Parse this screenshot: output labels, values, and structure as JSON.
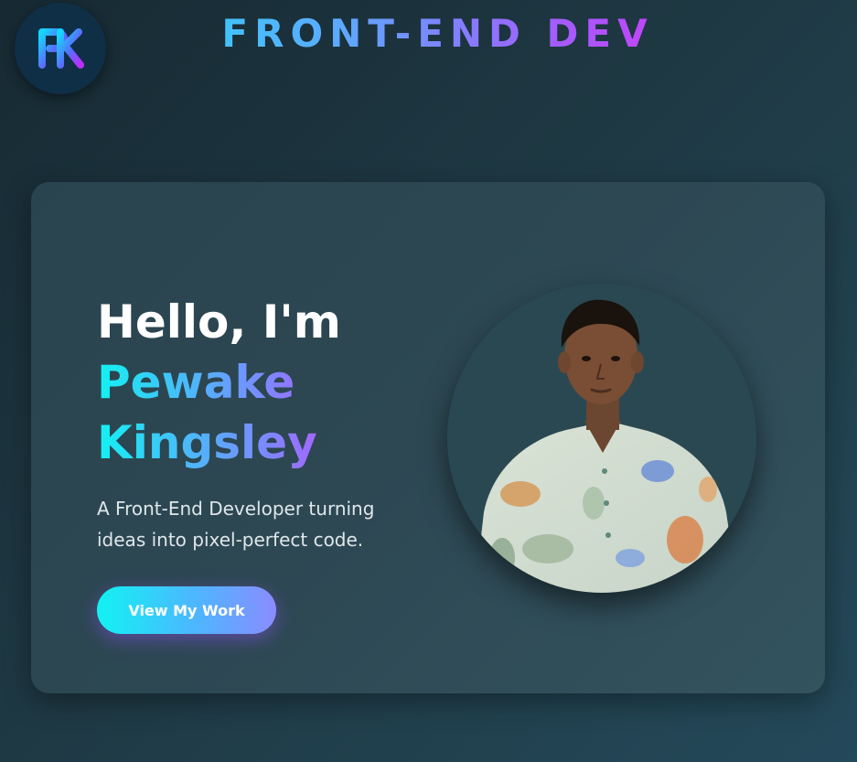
{
  "header": {
    "logo_text": "PK",
    "logo_icon": "pk-monogram-logo",
    "brand_title": "FRONT-END DEV"
  },
  "hero": {
    "greeting": "Hello, I'm",
    "name": "Pewake Kingsley",
    "tagline": "A Front-End Developer turning ideas into pixel-perfect code.",
    "cta_label": "View My Work",
    "profile_image": "profile-photo"
  },
  "colors": {
    "accent_cyan": "#12f2f2",
    "accent_purple": "#a35cff",
    "accent_magenta": "#ff17e8",
    "background": "#1f3a45",
    "card": "#2d4853"
  }
}
